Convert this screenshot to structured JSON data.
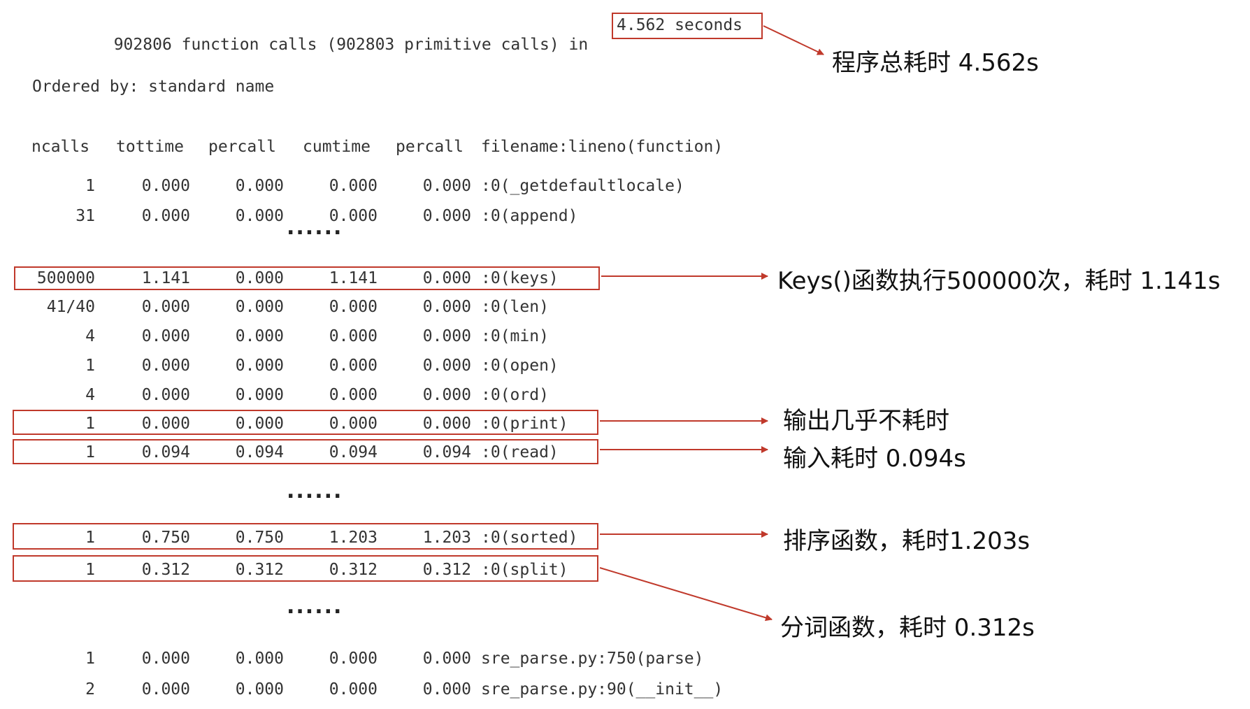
{
  "summary": {
    "calls_text": "902806 function calls (902803 primitive calls) in",
    "seconds_text": "4.562 seconds",
    "ordered_by": "Ordered by: standard name"
  },
  "columns": [
    "ncalls",
    "tottime",
    "percall",
    "cumtime",
    "percall",
    "filename:lineno(function)"
  ],
  "rows": [
    {
      "ncalls": "1",
      "tottime": "0.000",
      "percall1": "0.000",
      "cumtime": "0.000",
      "percall2": "0.000",
      "func": ":0(_getdefaultlocale)"
    },
    {
      "ncalls": "31",
      "tottime": "0.000",
      "percall1": "0.000",
      "cumtime": "0.000",
      "percall2": "0.000",
      "func": ":0(append)"
    },
    {
      "ncalls": "500000",
      "tottime": "1.141",
      "percall1": "0.000",
      "cumtime": "1.141",
      "percall2": "0.000",
      "func": ":0(keys)"
    },
    {
      "ncalls": "41/40",
      "tottime": "0.000",
      "percall1": "0.000",
      "cumtime": "0.000",
      "percall2": "0.000",
      "func": ":0(len)"
    },
    {
      "ncalls": "4",
      "tottime": "0.000",
      "percall1": "0.000",
      "cumtime": "0.000",
      "percall2": "0.000",
      "func": ":0(min)"
    },
    {
      "ncalls": "1",
      "tottime": "0.000",
      "percall1": "0.000",
      "cumtime": "0.000",
      "percall2": "0.000",
      "func": ":0(open)"
    },
    {
      "ncalls": "4",
      "tottime": "0.000",
      "percall1": "0.000",
      "cumtime": "0.000",
      "percall2": "0.000",
      "func": ":0(ord)"
    },
    {
      "ncalls": "1",
      "tottime": "0.000",
      "percall1": "0.000",
      "cumtime": "0.000",
      "percall2": "0.000",
      "func": ":0(print)"
    },
    {
      "ncalls": "1",
      "tottime": "0.094",
      "percall1": "0.094",
      "cumtime": "0.094",
      "percall2": "0.094",
      "func": ":0(read)"
    },
    {
      "ncalls": "1",
      "tottime": "0.750",
      "percall1": "0.750",
      "cumtime": "1.203",
      "percall2": "1.203",
      "func": ":0(sorted)"
    },
    {
      "ncalls": "1",
      "tottime": "0.312",
      "percall1": "0.312",
      "cumtime": "0.312",
      "percall2": "0.312",
      "func": ":0(split)"
    },
    {
      "ncalls": "1",
      "tottime": "0.000",
      "percall1": "0.000",
      "cumtime": "0.000",
      "percall2": "0.000",
      "func": "sre_parse.py:750(parse)"
    },
    {
      "ncalls": "2",
      "tottime": "0.000",
      "percall1": "0.000",
      "cumtime": "0.000",
      "percall2": "0.000",
      "func": "sre_parse.py:90(__init__)"
    }
  ],
  "ellipsis": "......",
  "annotations": {
    "total": "程序总耗时 4.562s",
    "keys": "Keys()函数执行500000次，耗时 1.141s",
    "print": "输出几乎不耗时",
    "read": "输入耗时 0.094s",
    "sorted": "排序函数，耗时1.203s",
    "split": "分词函数，耗时 0.312s"
  },
  "colors": {
    "highlight": "#c0392b",
    "text": "#333333"
  }
}
